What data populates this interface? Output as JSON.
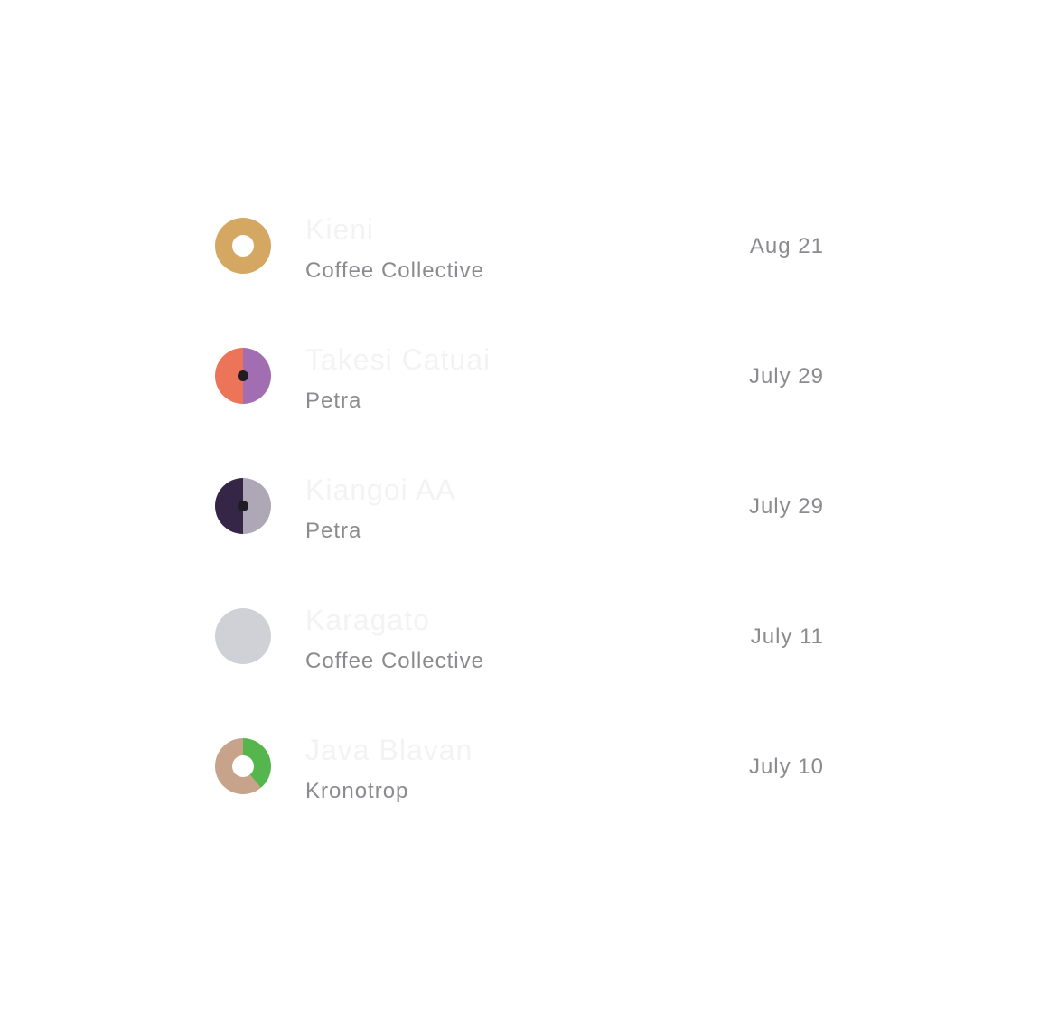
{
  "items": [
    {
      "name": "Kieni",
      "roaster": "Coffee Collective",
      "date": "Aug 21",
      "avatar_icon": "coffee-ring-icon",
      "avatar_colors": [
        "#d4a862"
      ]
    },
    {
      "name": "Takesi Catuai",
      "roaster": "Petra",
      "date": "July 29",
      "avatar_icon": "split-dot-icon",
      "avatar_colors": [
        "#ec7458",
        "#a26eb1"
      ]
    },
    {
      "name": "Kiangoi AA",
      "roaster": "Petra",
      "date": "July 29",
      "avatar_icon": "split-dot-icon",
      "avatar_colors": [
        "#352647",
        "#aea7b5"
      ]
    },
    {
      "name": "Karagato",
      "roaster": "Coffee Collective",
      "date": "July 11",
      "avatar_icon": "plain-circle-icon",
      "avatar_colors": [
        "#cfd1d7"
      ]
    },
    {
      "name": "Java Blavan",
      "roaster": "Kronotrop",
      "date": "July 10",
      "avatar_icon": "donut-progress-icon",
      "avatar_colors": [
        "#c8a38b",
        "#55b64e"
      ]
    }
  ]
}
